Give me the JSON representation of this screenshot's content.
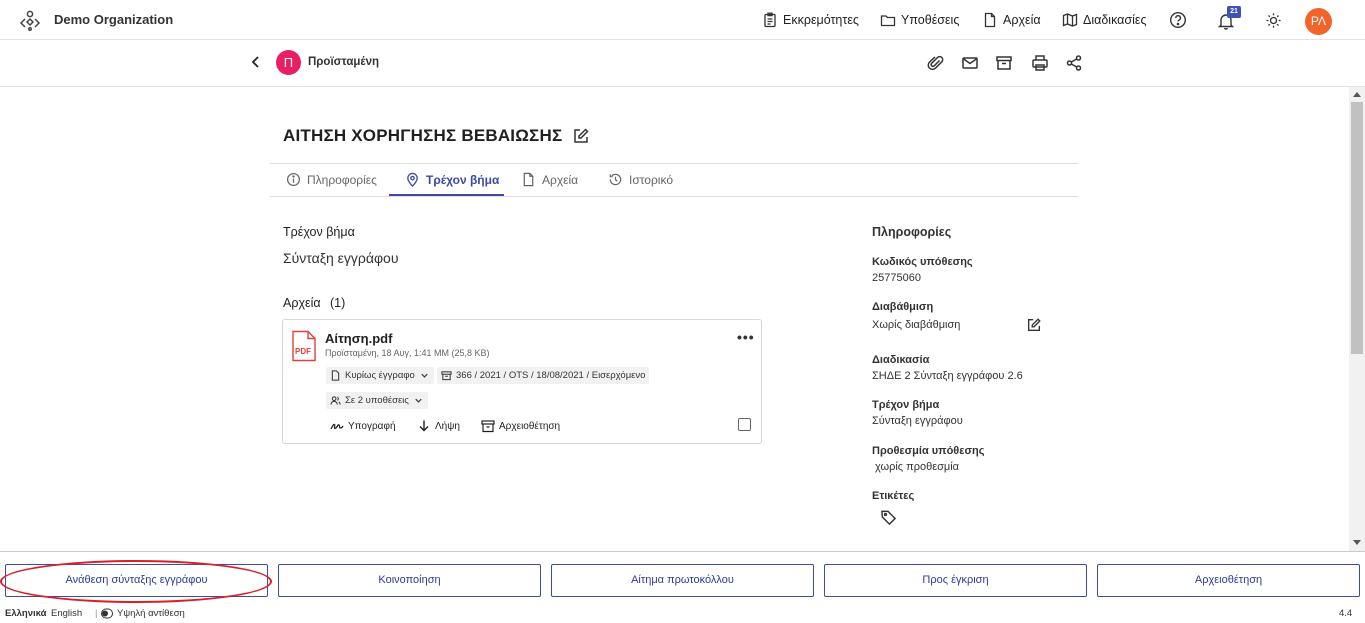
{
  "header": {
    "org_name": "Demo Organization",
    "nav": [
      {
        "label": "Εκκρεμότητες",
        "icon": "clipboard-icon"
      },
      {
        "label": "Υποθέσεις",
        "icon": "folder-icon"
      },
      {
        "label": "Αρχεία",
        "icon": "file-icon"
      },
      {
        "label": "Διαδικασίες",
        "icon": "map-icon"
      }
    ],
    "notifications_count": "21",
    "avatar_initials": "ΡΛ"
  },
  "subheader": {
    "user_initial": "Π",
    "user_name": "Προϊσταμένη"
  },
  "case": {
    "title": "ΑΙΤΗΣΗ ΧΟΡΗΓΗΣΗΣ ΒΕΒΑΙΩΣΗΣ",
    "tabs": [
      {
        "label": "Πληροφορίες",
        "icon": "info-icon"
      },
      {
        "label": "Τρέχον βήμα",
        "icon": "location-pin-icon",
        "active": true
      },
      {
        "label": "Αρχεία",
        "icon": "file-icon"
      },
      {
        "label": "Ιστορικό",
        "icon": "history-icon"
      }
    ],
    "current_step_label": "Τρέχον βήμα",
    "current_step_value": "Σύνταξη εγγράφου",
    "files_label": "Αρχεία",
    "files_count": "(1)"
  },
  "file": {
    "icon_text": "PDF",
    "name": "Αίτηση.pdf",
    "meta": "Προϊσταμένη, 18 Αυγ, 1:41 ΜΜ (25,8 KB)",
    "type_chip": "Κυρίως έγγραφο",
    "protocol_chip": "366 / 2021 / OTS / 18/08/2021 / Εισερχόμενο",
    "cases_chip": "Σε 2 υποθέσεις",
    "actions": {
      "sign": "Υπογραφή",
      "download": "Λήψη",
      "archive": "Αρχειοθέτηση"
    },
    "more": "•••"
  },
  "info_panel": {
    "heading": "Πληροφορίες",
    "case_code_label": "Κωδικός υπόθεσης",
    "case_code_value": "25775060",
    "classification_label": "Διαβάθμιση",
    "classification_value": "Χωρίς διαβάθμιση",
    "procedure_label": "Διαδικασία",
    "procedure_value": "ΣΗΔΕ 2 Σύνταξη εγγράφου 2.6",
    "step_label": "Τρέχον βήμα",
    "step_value": "Σύνταξη εγγράφου",
    "deadline_label": "Προθεσμία υπόθεσης",
    "deadline_value": "χωρίς προθεσμία",
    "tags_label": "Ετικέτες"
  },
  "bottom_buttons": [
    "Ανάθεση σύνταξης εγγράφου",
    "Κοινοποίηση",
    "Αίτημα πρωτοκόλλου",
    "Προς έγκριση",
    "Αρχειοθέτηση"
  ],
  "footer": {
    "lang_el": "Ελληνικά",
    "lang_en": "English",
    "contrast": "Υψηλή αντίθεση",
    "version": "4.4"
  },
  "colors": {
    "accent": "#3d4aa8",
    "avatar": "#f2642a",
    "user_badge": "#e91e63",
    "highlight": "#d9202a"
  }
}
